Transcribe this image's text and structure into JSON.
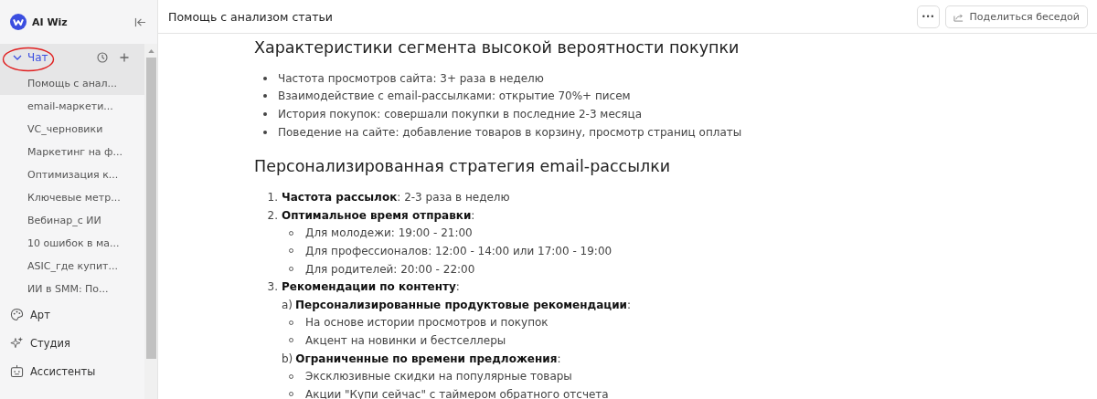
{
  "brand": {
    "name": "AI Wiz"
  },
  "sidebar": {
    "section": {
      "label": "Чат",
      "expanded": true,
      "items": [
        {
          "label": "Помощь с анал...",
          "selected": true
        },
        {
          "label": "email-маркети...",
          "selected": false
        },
        {
          "label": "VC_черновики",
          "selected": false
        },
        {
          "label": "Маркетинг на ф...",
          "selected": false
        },
        {
          "label": "Оптимизация к...",
          "selected": false
        },
        {
          "label": "Ключевые метр...",
          "selected": false
        },
        {
          "label": "Вебинар_с ИИ",
          "selected": false
        },
        {
          "label": "10 ошибок в ма...",
          "selected": false
        },
        {
          "label": "ASIC_где купит...",
          "selected": false
        },
        {
          "label": "ИИ в SMM: По...",
          "selected": false
        }
      ]
    },
    "nav": [
      {
        "label": "Арт",
        "kind": "art"
      },
      {
        "label": "Студия",
        "kind": "studio"
      },
      {
        "label": "Ассистенты",
        "kind": "assistants"
      }
    ]
  },
  "header": {
    "title": "Помощь с анализом статьи",
    "more_button": "•••",
    "share_button": "Поделиться беседой"
  },
  "content": [
    {
      "kind": "heading",
      "text": "Характеристики сегмента высокой вероятности покупки"
    },
    {
      "kind": "bullets",
      "items": [
        "Частота просмотров сайта: 3+ раза в неделю",
        "Взаимодействие с email-рассылками: открытие 70%+ писем",
        "История покупок: совершали покупки в последние 2-3 месяца",
        "Поведение на сайте: добавление товаров в корзину, просмотр страниц оплаты"
      ]
    },
    {
      "kind": "heading",
      "text": "Персонализированная стратегия email-рассылки"
    },
    {
      "kind": "ordered",
      "items": [
        {
          "marker": "1.",
          "text": "**Частота рассылок**: 2-3 раза в неделю"
        },
        {
          "marker": "2.",
          "text": "**Оптимальное время отправки**:",
          "children": [
            "Для молодежи: 19:00 - 21:00",
            "Для профессионалов: 12:00 - 14:00 или 17:00 - 19:00",
            "Для родителей: 20:00 - 22:00"
          ]
        },
        {
          "marker": "3.",
          "text": "**Рекомендации по контенту**:",
          "sub": [
            {
              "marker": "a)",
              "text": "**Персонализированные продуктовые рекомендации**:",
              "children": [
                "На основе истории просмотров и покупок",
                "Акцент на новинки и бестселлеры"
              ]
            },
            {
              "marker": "b)",
              "text": "**Ограниченные по времени предложения**:",
              "children": [
                "Эксклюзивные скидки на популярные товары",
                "Акции \"Купи сейчас\" с таймером обратного отсчета"
              ]
            }
          ]
        }
      ]
    }
  ]
}
